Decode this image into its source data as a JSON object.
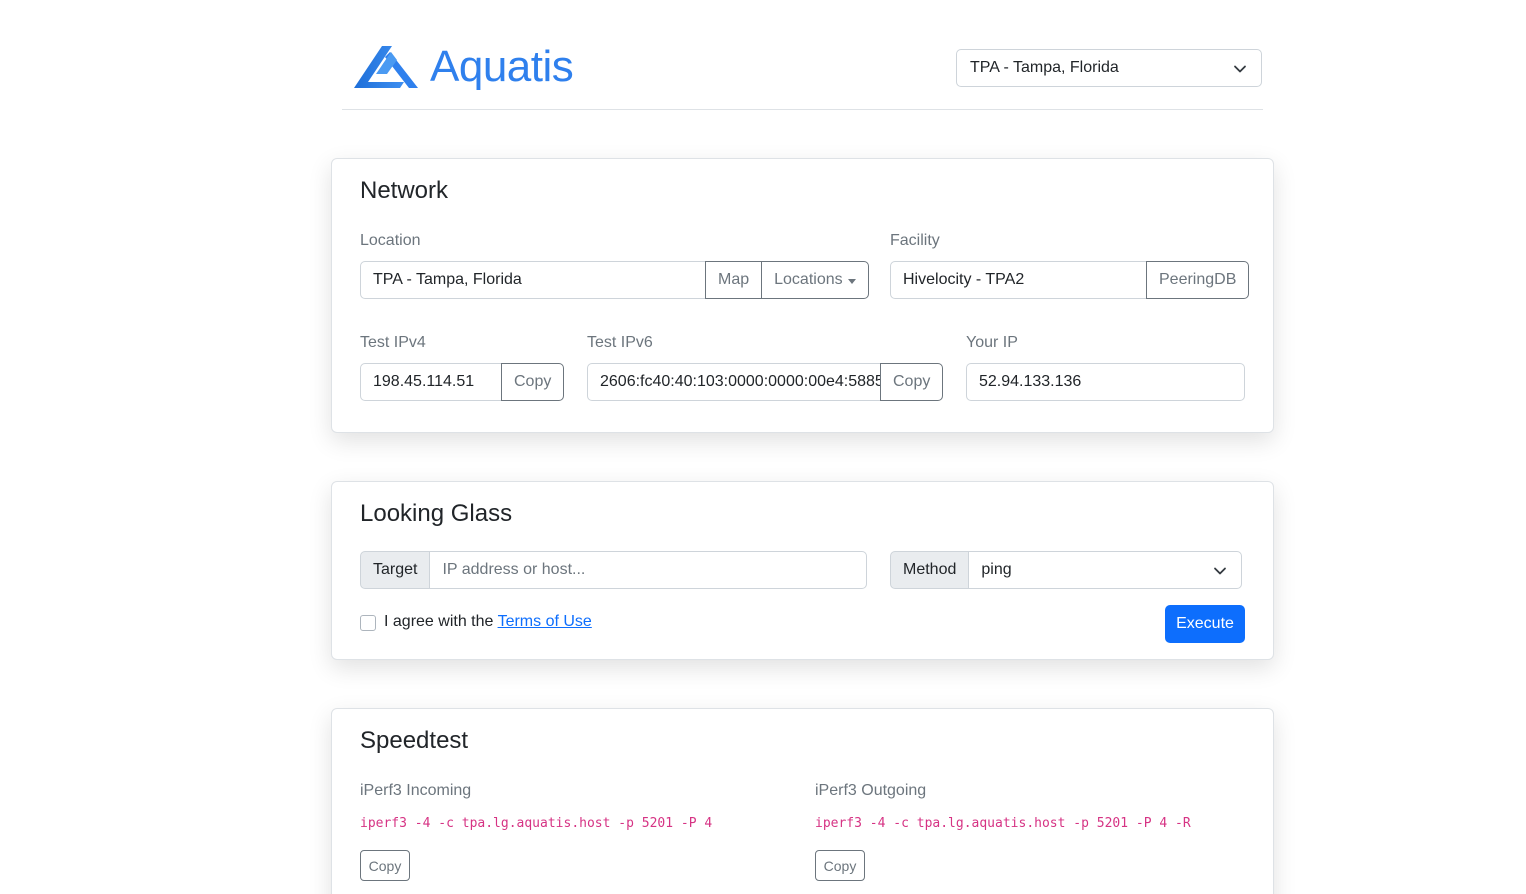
{
  "header": {
    "logo_text": "Aquatis",
    "location_select": "TPA - Tampa, Florida",
    "brand_color": "#2f80ed"
  },
  "network": {
    "title": "Network",
    "location_label": "Location",
    "location_value": "TPA - Tampa, Florida",
    "map_button": "Map",
    "locations_button": "Locations",
    "facility_label": "Facility",
    "facility_value": "Hivelocity - TPA2",
    "peeringdb_button": "PeeringDB",
    "ipv4_label": "Test IPv4",
    "ipv4_value": "198.45.114.51",
    "ipv6_label": "Test IPv6",
    "ipv6_value": "2606:fc40:40:103:0000:0000:00e4:5885",
    "your_ip_label": "Your IP",
    "your_ip_value": "52.94.133.136",
    "copy_label": "Copy"
  },
  "looking_glass": {
    "title": "Looking Glass",
    "target_label": "Target",
    "target_placeholder": "IP address or host...",
    "method_label": "Method",
    "method_value": "ping",
    "agree_text": "I agree with the ",
    "terms_link": "Terms of Use",
    "execute_button": "Execute",
    "accent_color": "#0d6efd"
  },
  "speedtest": {
    "title": "Speedtest",
    "incoming_label": "iPerf3 Incoming",
    "incoming_cmd": "iperf3 -4 -c tpa.lg.aquatis.host -p 5201 -P 4",
    "outgoing_label": "iPerf3 Outgoing",
    "outgoing_cmd": "iperf3 -4 -c tpa.lg.aquatis.host -p 5201 -P 4 -R",
    "copy_label": "Copy"
  }
}
